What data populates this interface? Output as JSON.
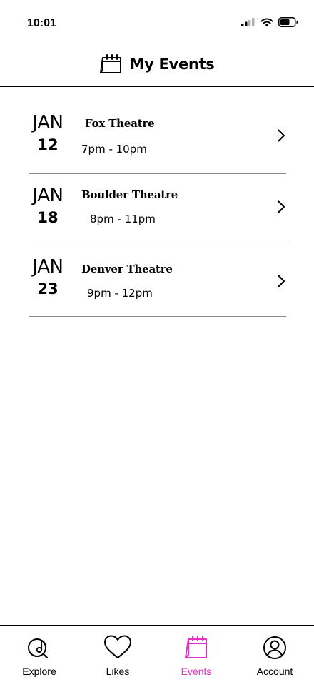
{
  "status_bar": {
    "time": "10:01"
  },
  "header": {
    "title": "My Events",
    "icon": "calendar-icon"
  },
  "events": [
    {
      "month": "JAN",
      "day": "12",
      "venue": "Fox Theatre",
      "time": "7pm - 10pm"
    },
    {
      "month": "JAN",
      "day": "18",
      "venue": "Boulder Theatre",
      "time": "8pm - 11pm"
    },
    {
      "month": "JAN",
      "day": "23",
      "venue": "Denver Theatre",
      "time": "9pm - 12pm"
    }
  ],
  "tab_bar": {
    "tabs": [
      {
        "label": "Explore",
        "icon": "music-search-icon",
        "active": false
      },
      {
        "label": "Likes",
        "icon": "heart-icon",
        "active": false
      },
      {
        "label": "Events",
        "icon": "calendar-icon",
        "active": true
      },
      {
        "label": "Account",
        "icon": "account-icon",
        "active": false
      }
    ]
  },
  "colors": {
    "accent": "#e52fc3",
    "divider": "#8a8a8a",
    "text": "#000000"
  }
}
